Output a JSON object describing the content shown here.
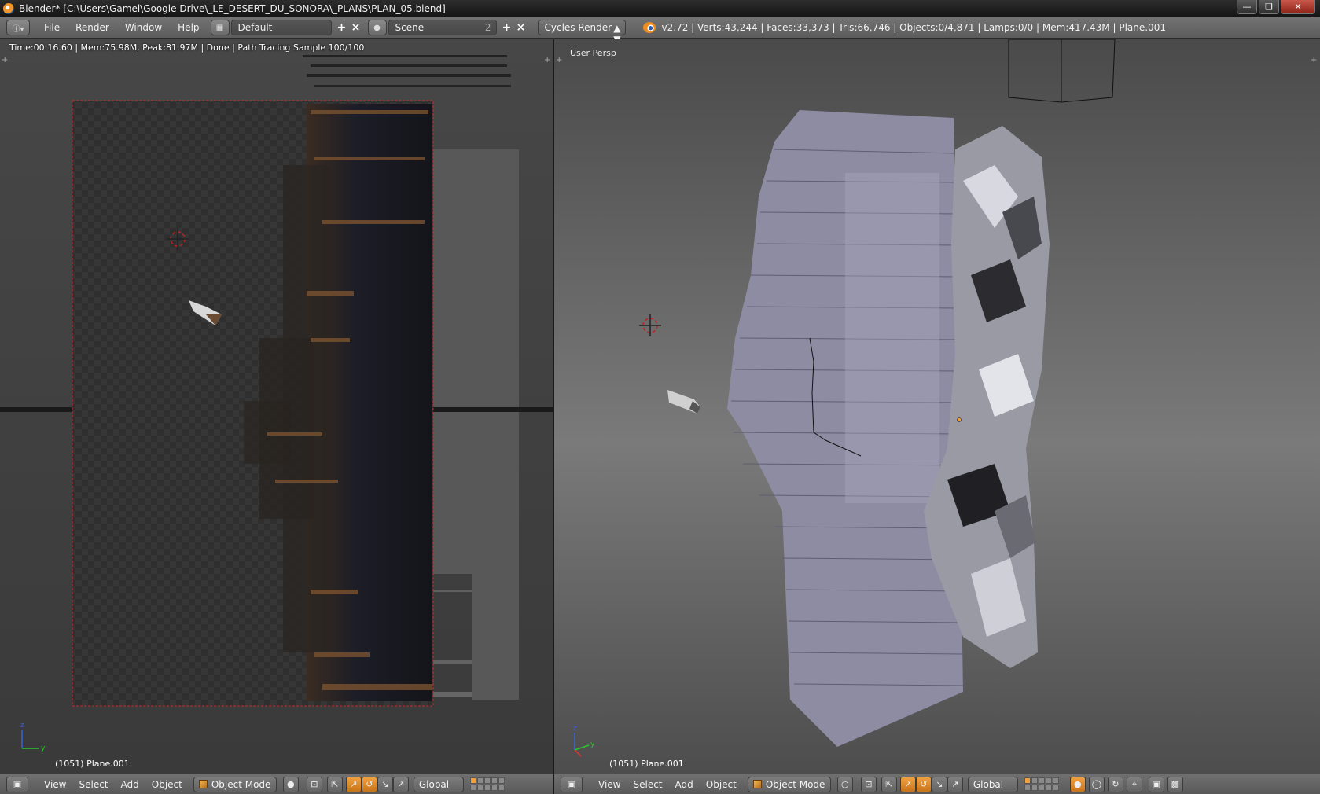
{
  "titlebar": {
    "title": "Blender* [C:\\Users\\Gamel\\Google Drive\\_LE_DESERT_DU_SONORA\\_PLANS\\PLAN_05.blend]",
    "minimize_icon": "minimize-icon",
    "maximize_icon": "maximize-icon",
    "close_icon": "close-icon"
  },
  "infobar": {
    "menus": [
      "File",
      "Render",
      "Window",
      "Help"
    ],
    "screen_layout": "Default",
    "scene": "Scene",
    "scene_users": "2",
    "render_engine": "Cycles Render",
    "stats": "v2.72 | Verts:43,244 | Faces:33,373 | Tris:66,746 | Objects:0/4,871 | Lamps:0/0 | Mem:417.43M | Plane.001"
  },
  "left_view": {
    "render_status": "Time:00:16.60 | Mem:75.98M, Peak:81.97M | Done | Path Tracing Sample 100/100",
    "object_info": "(1051) Plane.001",
    "axis_labels": [
      "z",
      "y"
    ]
  },
  "right_view": {
    "view_name": "User Persp",
    "object_info": "(1051) Plane.001",
    "axis_labels": [
      "z",
      "y"
    ]
  },
  "bottombar": {
    "menus": [
      "View",
      "Select",
      "Add",
      "Object"
    ],
    "mode": "Object Mode",
    "orientation": "Global"
  },
  "colors": {
    "accent_orange": "#f0a040",
    "header_grey": "#666666",
    "mesh_lilac": "#a9a7c2"
  }
}
